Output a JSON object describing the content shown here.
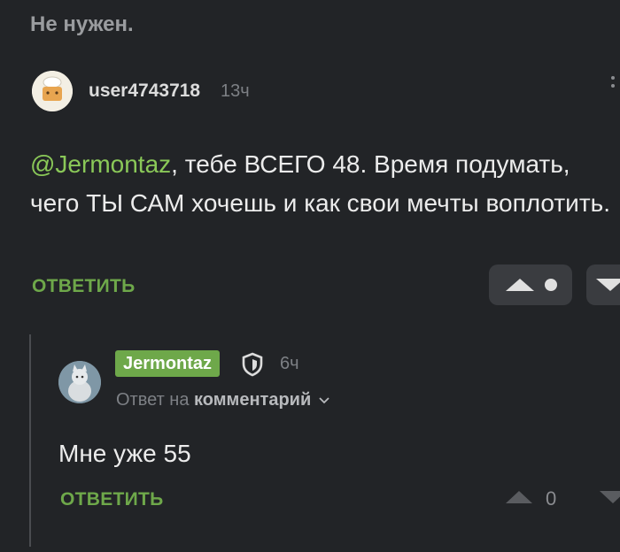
{
  "previous": {
    "text": "Не нужен."
  },
  "comment1": {
    "username": "user4743718",
    "time": "13ч",
    "mention": "@Jermontaz",
    "body": ", тебе ВСЕГО 48. Время подумать, чего ТЫ САМ хочешь и как свои мечты воплотить.",
    "reply_label": "ОТВЕТИТЬ"
  },
  "comment2": {
    "username": "Jermontaz",
    "time": "6ч",
    "reply_to_prefix": "Ответ на",
    "reply_to_link": "комментарий",
    "body": "Мне уже 55",
    "reply_label": "ОТВЕТИТЬ",
    "score": "0"
  },
  "colors": {
    "background": "#222427",
    "accent_green": "#6ea84a",
    "mention_green": "#8ac858",
    "muted": "#7d8085"
  },
  "icons": [
    "more-vertical-icon",
    "upvote-icon",
    "downvote-icon",
    "shield-icon",
    "chevron-down-icon",
    "avatar-chef-icon",
    "avatar-cat-icon"
  ]
}
